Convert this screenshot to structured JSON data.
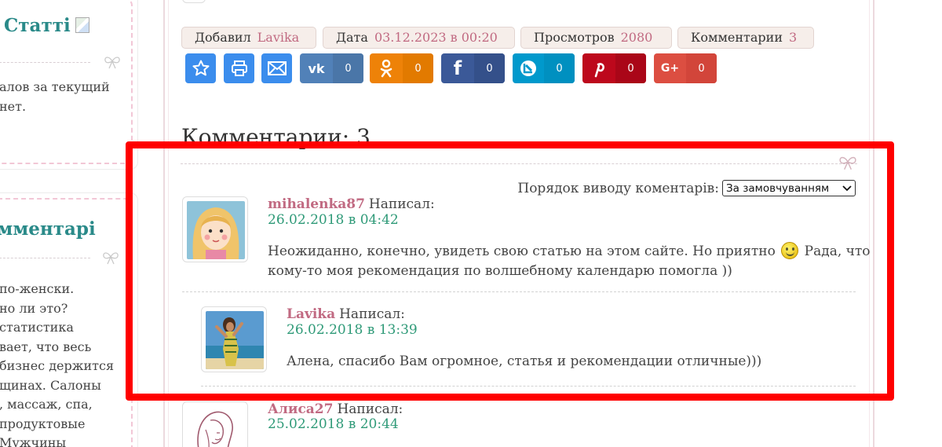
{
  "sidebar": {
    "widget1": {
      "title": "Статті",
      "lines": [
        "алов за текущий",
        "нет."
      ]
    },
    "widget2": {
      "title": "омментарі",
      "lines": [
        "по-женски.",
        "но ли это?",
        "статистика",
        "вает, что весь",
        "бизнес держится",
        "щинах. Салоны",
        ", массаж, спа,",
        "продуктовые",
        "Мужчины"
      ]
    }
  },
  "meta": {
    "added_label": "Добавил",
    "added_value": "Lavika",
    "date_label": "Дата",
    "date_value": "03.12.2023 в 00:20",
    "views_label": "Просмотров",
    "views_value": "2080",
    "comments_label": "Комментарии",
    "comments_value": "3"
  },
  "share": [
    {
      "name": "favorite",
      "icon": "star-icon",
      "color": "#3b8ded",
      "count": null
    },
    {
      "name": "print",
      "icon": "printer-icon",
      "color": "#3b8ded",
      "count": null
    },
    {
      "name": "email",
      "icon": "mail-icon",
      "color": "#3b8ded",
      "count": null
    },
    {
      "name": "vk",
      "icon": "vk-icon",
      "color": "#5181b8",
      "count": "0"
    },
    {
      "name": "ok",
      "icon": "odnoklassniki-icon",
      "color": "#ee8208",
      "count": "0"
    },
    {
      "name": "facebook",
      "icon": "facebook-icon",
      "color": "#3b5998",
      "count": "0"
    },
    {
      "name": "livejournal",
      "icon": "livejournal-icon",
      "color": "#0099cc",
      "count": "0"
    },
    {
      "name": "pinterest",
      "icon": "pinterest-icon",
      "color": "#bd081c",
      "count": "0"
    },
    {
      "name": "googleplus",
      "icon": "google-plus-icon",
      "color": "#dc4e41",
      "count": "0"
    }
  ],
  "comments_section": {
    "heading": "Комментарии: 3",
    "order_label": "Порядок виводу коментарів:",
    "order_selected": "За замовчуванням"
  },
  "comments": [
    {
      "author": "mihalenka87",
      "wrote": "Написал:",
      "date": "26.02.2018 в 04:42",
      "text_line1_a": "Неожиданно, конечно, увидеть свою статью на этом сайте. Но приятно",
      "text_line1_b": "Рада, что",
      "text_line2": "кому-то моя рекомендация по волшебному календарю помогла ))",
      "avatar": "cartoon-girl-avatar"
    },
    {
      "author": "Lavika",
      "wrote": "Написал:",
      "date": "26.02.2018 в 13:39",
      "text": "Алена, спасибо Вам огромное, статья и рекомендации отличные)))",
      "avatar": "beach-photo-avatar"
    },
    {
      "author": "Алиса27",
      "wrote": "Написал:",
      "date": "25.02.2018 в 20:44",
      "avatar": "sketch-woman-avatar"
    }
  ],
  "colors": {
    "accent_pink": "#c16a82",
    "date_green": "#2f9a78",
    "title_teal": "#2a8a89",
    "highlight_red": "#ff0000"
  }
}
